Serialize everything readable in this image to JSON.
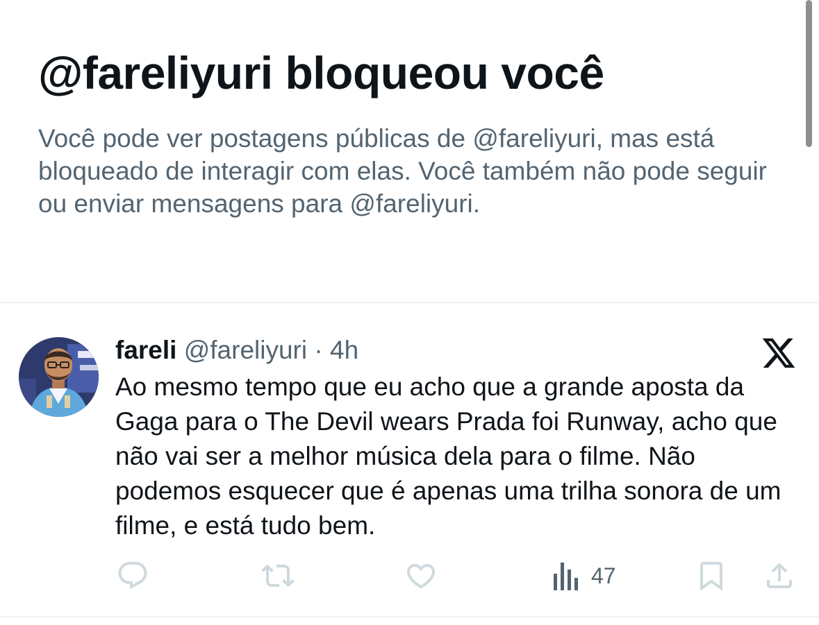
{
  "block_notice": {
    "title": "@fareliyuri bloqueou você",
    "description": "Você pode ver postagens públicas de @fareliyuri, mas está bloqueado de interagir com elas. Você também não pode seguir ou enviar mensagens para @fareliyuri."
  },
  "tweet": {
    "author_name": "fareli",
    "author_handle": "@fareliyuri",
    "separator": "·",
    "time": "4h",
    "text": "Ao mesmo tempo que eu acho que a grande aposta da Gaga para o The Devil wears Prada foi Runway, acho que não vai ser a melhor música dela para o filme. Não podemos esquecer que é apenas uma trilha sonora de um filme, e está tudo bem.",
    "views": "47"
  },
  "icons": {
    "reply": "reply-icon",
    "retweet": "retweet-icon",
    "like": "heart-icon",
    "views": "analytics-icon",
    "bookmark": "bookmark-icon",
    "share": "share-icon",
    "platform": "x-logo-icon"
  },
  "colors": {
    "primary_text": "#0f1419",
    "secondary_text": "#536471",
    "divider": "#eff3f4",
    "action_icon": "#cfd9de",
    "views_icon": "#536471"
  }
}
